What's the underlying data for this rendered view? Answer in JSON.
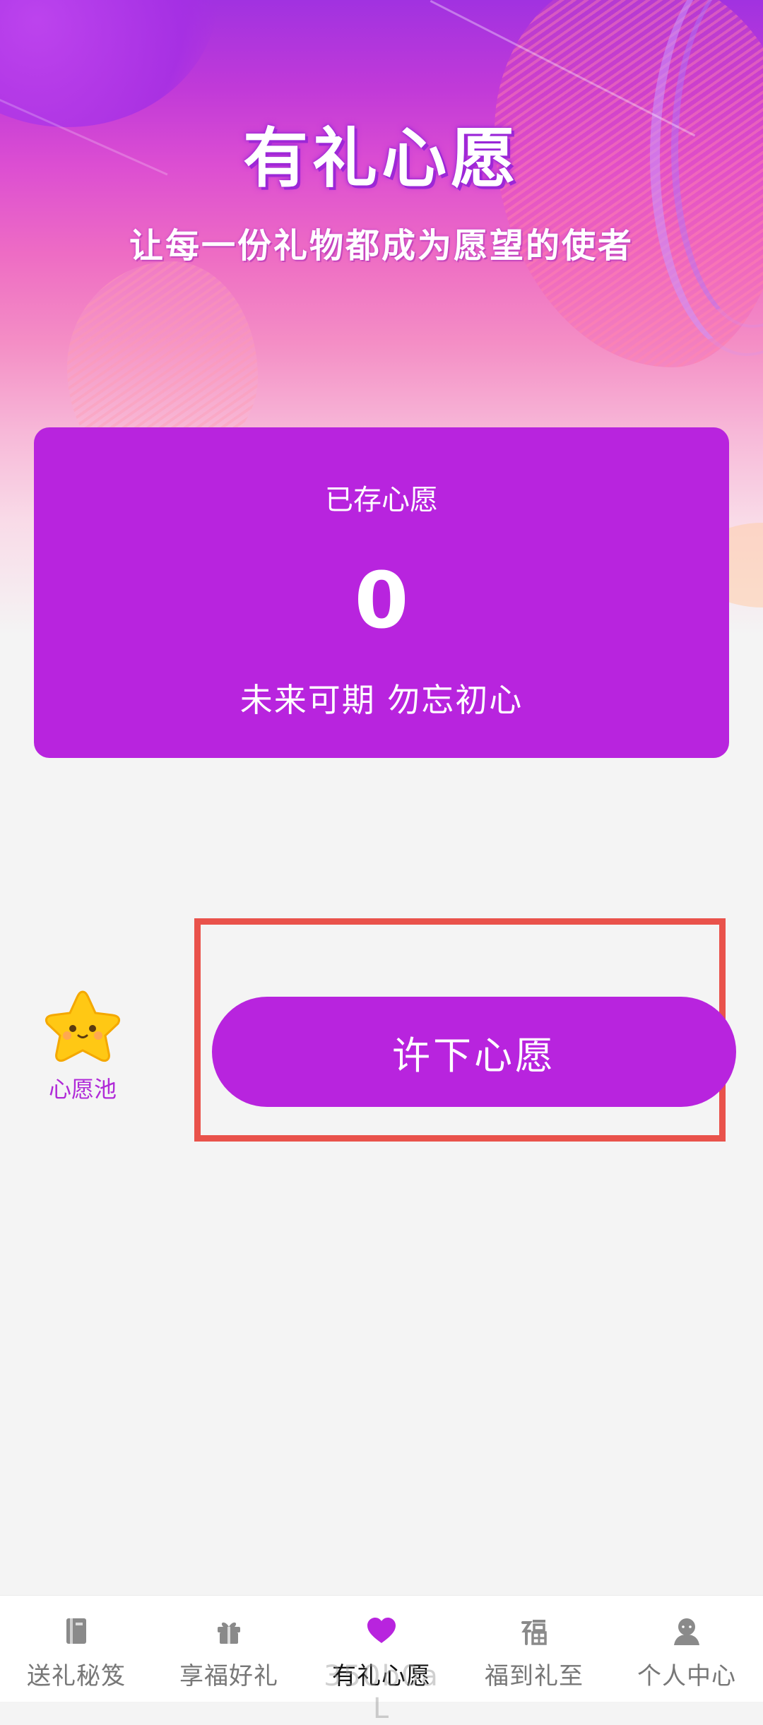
{
  "hero": {
    "title": "有礼心愿",
    "subtitle": "让每一份礼物都成为愿望的使者"
  },
  "wish_card": {
    "label": "已存心愿",
    "count": "0",
    "slogan": "未来可期 勿忘初心"
  },
  "wish_pool": {
    "icon": "star-icon",
    "label": "心愿池"
  },
  "make_wish_button": {
    "label": "许下心愿"
  },
  "tab_bar": {
    "items": [
      {
        "label": "送礼秘笈",
        "icon": "book-icon",
        "active": false
      },
      {
        "label": "享福好礼",
        "icon": "gift-icon",
        "active": false
      },
      {
        "label": "有礼心愿",
        "icon": "heart-icon",
        "active": true
      },
      {
        "label": "福到礼至",
        "icon": "fu-icon",
        "active": false
      },
      {
        "label": "个人中心",
        "icon": "user-icon",
        "active": false
      }
    ]
  },
  "watermark": "350b0a L",
  "colors": {
    "accent": "#b824de",
    "highlight": "#e9524b",
    "tab_inactive": "#777777",
    "tab_active_icon": "#b824de"
  }
}
